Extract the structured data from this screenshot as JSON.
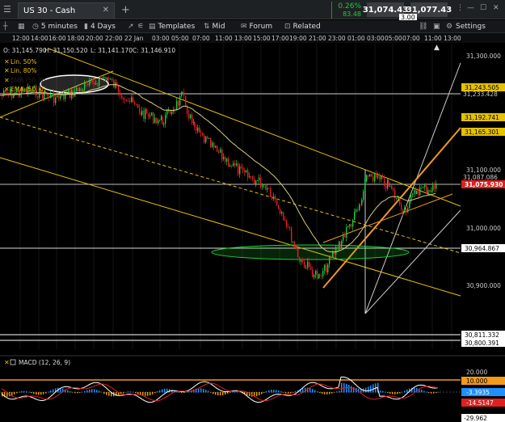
{
  "tab": {
    "title": "US 30 - Cash"
  },
  "quote": {
    "change_pct": "0.26%",
    "change_pts": "83.48",
    "bid": "31,074.43",
    "ask": "31,077.43",
    "spread": "3.00"
  },
  "toolbar": {
    "interval": "5 minutes",
    "range": "4 Days",
    "templates": "Templates",
    "price_type": "Mid",
    "forum": "Forum",
    "related": "Related",
    "settings": "Settings"
  },
  "time_axis": [
    "12:00",
    "14:00",
    "16:00",
    "18:00",
    "20:00",
    "22:00",
    "22 Jan",
    "03:00",
    "05:00",
    "07:00",
    "11:00",
    "13:00",
    "15:00",
    "17:00",
    "19:00",
    "21:00",
    "23:00",
    "01:00",
    "03:00",
    "05:00",
    "07:00",
    "11:00",
    "13:00"
  ],
  "ohlc": {
    "o": "O: 31,145.790",
    "h": "H: 31,150.520",
    "l": "L: 31,141.170",
    "c": "C: 31,146.910"
  },
  "indicators": [
    "Lin. 50%",
    "Lin. 80%",
    "EMA (50, 0)",
    "EMA (50, 0)"
  ],
  "price_labels": {
    "p31300": "31,300.000",
    "p31243": "31,243.505",
    "p31233": "31,233.428",
    "p31192": "31,192.741",
    "p31165": "31,165.301",
    "p31100": "31,100.000",
    "p31087": "31,087.086",
    "p31075": "31,075.930",
    "p31000": "31,000.000",
    "p30964": "30,964.867",
    "p30900": "30,900.000",
    "p30811": "30,811.332",
    "p30800": "30,800.391"
  },
  "macd": {
    "label": "MACD (12, 26, 9)",
    "y20": "20.000",
    "y10": "10.000",
    "v1": "-3.3935",
    "v2": "-14.5147",
    "bottom": "-29.962"
  },
  "colors": {
    "up": "#1ecc3c",
    "down": "#e02020",
    "channel": "#e5c100",
    "trend": "#f39a1a",
    "blue_badge": "#1e90ff"
  }
}
